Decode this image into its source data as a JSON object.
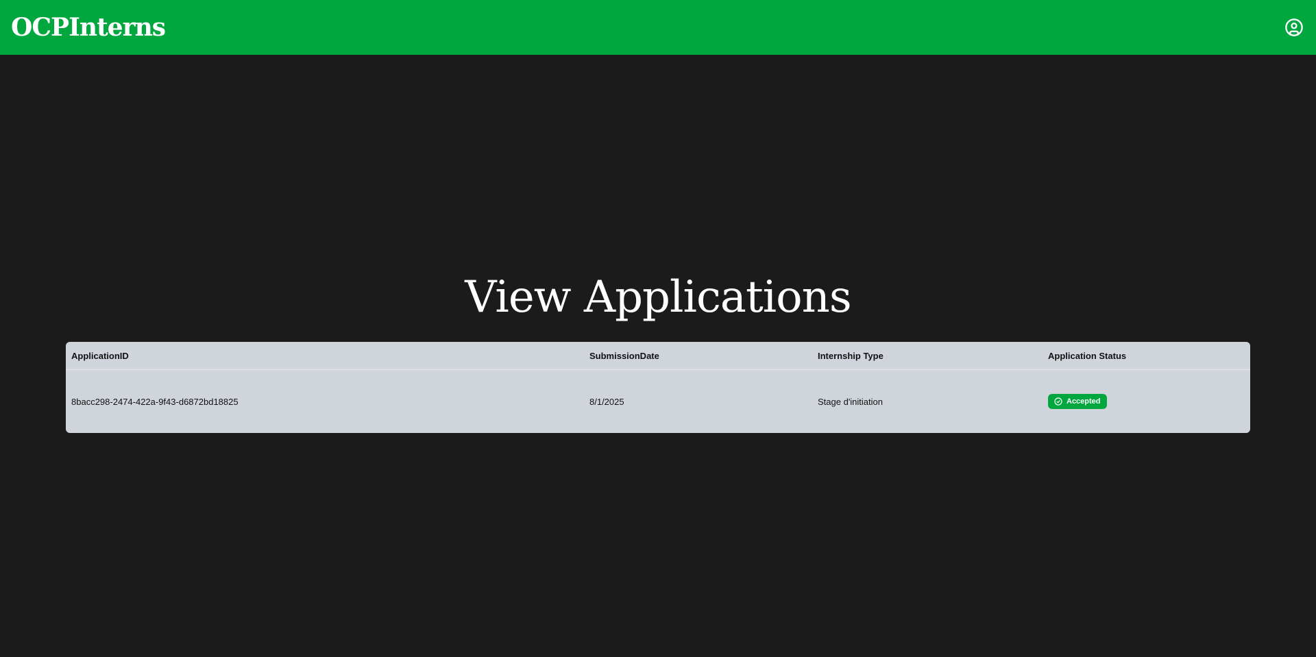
{
  "header": {
    "brand": "OCPInterns",
    "account_icon": "user-circle-icon",
    "background_color": "#00a63e"
  },
  "main": {
    "title": "View Applications"
  },
  "table": {
    "columns": [
      "ApplicationID",
      "SubmissionDate",
      "Internship Type",
      "Application Status"
    ],
    "rows": [
      {
        "application_id": "8bacc298-2474-422a-9f43-d6872bd18825",
        "submission_date": "8/1/2025",
        "internship_type": "Stage d'initiation",
        "status": "Accepted",
        "status_icon": "check-circle-icon",
        "status_color": "#00a63e"
      }
    ]
  }
}
